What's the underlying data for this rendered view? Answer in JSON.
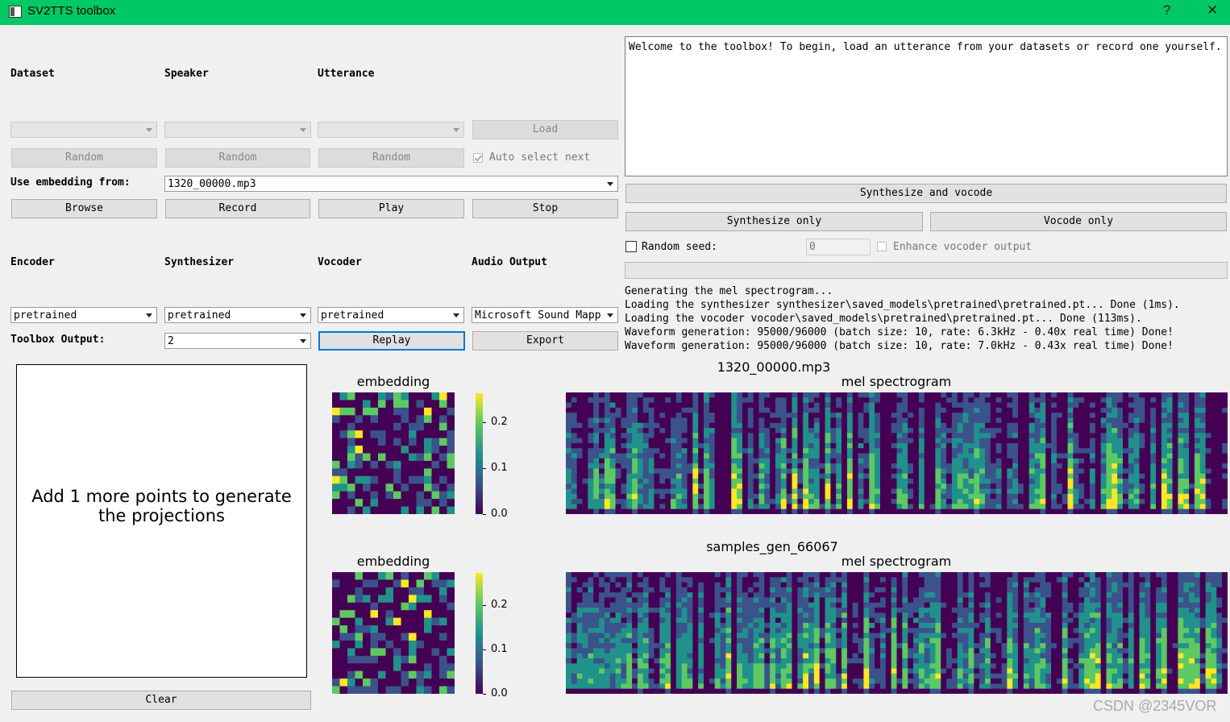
{
  "window": {
    "title": "SV2TTS toolbox",
    "help": "?",
    "close": "✕"
  },
  "browser": {
    "dataset_label": "Dataset",
    "speaker_label": "Speaker",
    "utterance_label": "Utterance",
    "load": "Load",
    "random": "Random",
    "auto_select_next": "Auto select next",
    "use_embedding_label": "Use embedding from:",
    "use_embedding_value": "1320_00000.mp3",
    "browse": "Browse",
    "record": "Record",
    "play": "Play",
    "stop": "Stop"
  },
  "models": {
    "encoder_label": "Encoder",
    "synthesizer_label": "Synthesizer",
    "vocoder_label": "Vocoder",
    "audio_output_label": "Audio Output",
    "encoder_value": "pretrained",
    "synthesizer_value": "pretrained",
    "vocoder_value": "pretrained",
    "audio_output_value": "Microsoft Sound Mapp",
    "toolbox_output_label": "Toolbox Output:",
    "toolbox_output_value": "2",
    "replay": "Replay",
    "export": "Export"
  },
  "generation": {
    "text": "Welcome to the toolbox! To begin, load an utterance from your datasets or record one yourself.",
    "synthesize_and_vocode": "Synthesize and vocode",
    "synthesize_only": "Synthesize only",
    "vocode_only": "Vocode only",
    "random_seed_label": "Random seed:",
    "random_seed_value": "0",
    "enhance_label": "Enhance vocoder output",
    "log": [
      "Generating the mel spectrogram...",
      "Loading the synthesizer synthesizer\\saved_models\\pretrained\\pretrained.pt... Done (1ms).",
      "Loading the vocoder vocoder\\saved_models\\pretrained\\pretrained.pt... Done (113ms).",
      "Waveform generation: 95000/96000 (batch size: 10, rate: 6.3kHz - 0.40x real time) Done!",
      "Waveform generation: 95000/96000 (batch size: 10, rate: 7.0kHz - 0.43x real time) Done!"
    ]
  },
  "projections": {
    "message": "Add 1 more points to generate the projections",
    "clear": "Clear"
  },
  "plots": {
    "top": {
      "utterance": "1320_00000.mp3",
      "embedding_title": "embedding",
      "spec_title": "mel spectrogram"
    },
    "bottom": {
      "utterance": "samples_gen_66067",
      "embedding_title": "embedding",
      "spec_title": "mel spectrogram"
    },
    "colorbar_ticks": [
      "0.2",
      "0.1",
      "0.0"
    ],
    "colormap": [
      "#440154",
      "#3b528b",
      "#21918c",
      "#5ec962",
      "#fde725"
    ]
  },
  "watermark": "CSDN @2345VOR"
}
